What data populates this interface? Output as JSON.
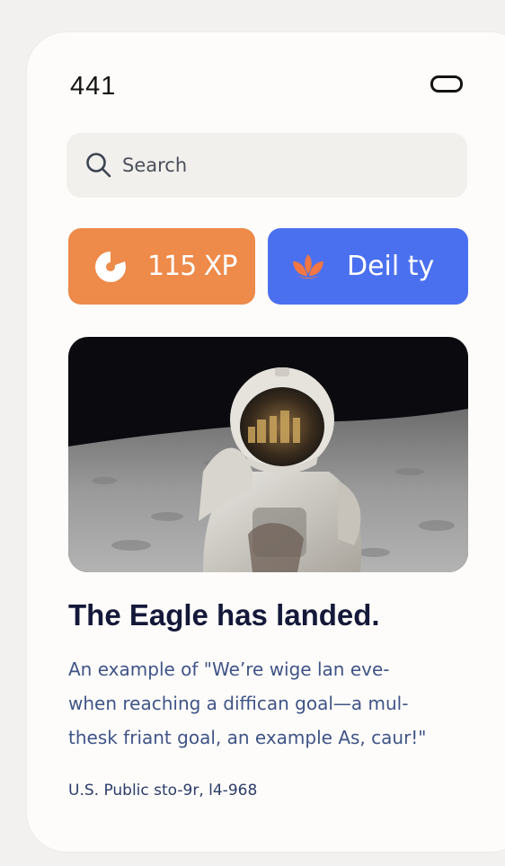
{
  "status_bar": {
    "time": "441"
  },
  "search": {
    "placeholder": "Search"
  },
  "stats": {
    "xp_label": "115 XP",
    "daily_label": "Deil ty"
  },
  "feature": {
    "title": "The Eagle has landed.",
    "body": "An example of \"We’re wige lan eve-\nwhen reaching a diffican goal—a mul-\nthesk friant goal, an example As, caur!\"",
    "credit": "U.S. Public sto-9r, l4-968"
  },
  "colors": {
    "xp_pill": "#ee8a4a",
    "daily_pill": "#4b70ef",
    "title_text": "#14193a",
    "body_text": "#3f5487"
  },
  "icons": {
    "xp": "xp-pie-icon",
    "daily": "lotus-icon",
    "search": "search-icon",
    "battery": "battery-icon"
  }
}
